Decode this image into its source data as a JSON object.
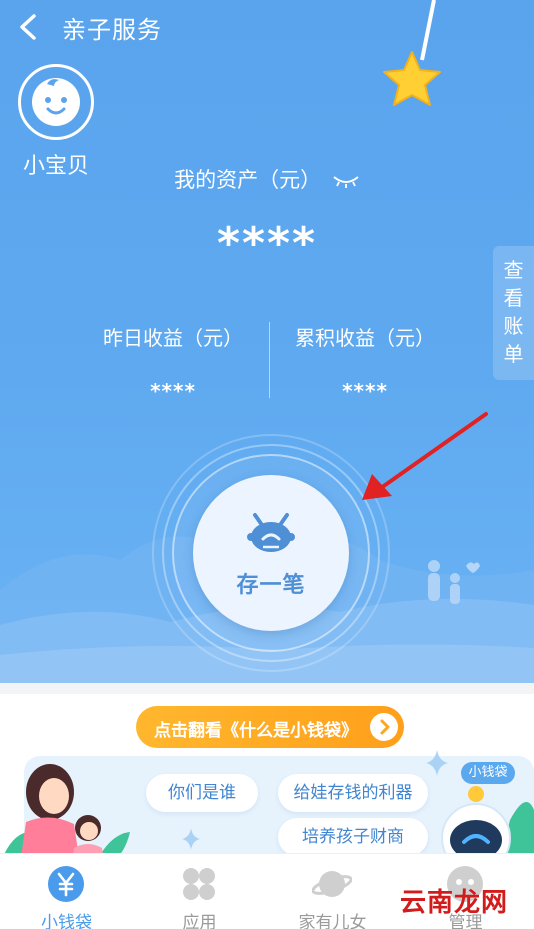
{
  "header": {
    "title": "亲子服务"
  },
  "profile": {
    "name": "小宝贝"
  },
  "assets": {
    "label": "我的资产（元）",
    "value": "****"
  },
  "earnings": {
    "yesterday_label": "昨日收益（元）",
    "yesterday_value": "****",
    "total_label": "累积收益（元）",
    "total_value": "****"
  },
  "side_tab": {
    "chars": [
      "查",
      "看",
      "账",
      "单"
    ]
  },
  "deposit": {
    "label": "存一笔"
  },
  "guide": {
    "text": "点击翻看《什么是小钱袋》"
  },
  "banner": {
    "chips": [
      "你们是谁",
      "给娃存钱的利器",
      "培养孩子财商"
    ],
    "tag": "小钱袋"
  },
  "tabbar": {
    "items": [
      {
        "label": "小钱袋",
        "icon": "yen-coin-icon",
        "active": true
      },
      {
        "label": "应用",
        "icon": "apps-clover-icon",
        "active": false
      },
      {
        "label": "家有儿女",
        "icon": "planet-icon",
        "active": false
      },
      {
        "label": "管理",
        "icon": "robot-face-icon",
        "active": false
      }
    ]
  },
  "watermark": {
    "text": "云南龙网"
  },
  "colors": {
    "primary": "#5aa4ee",
    "accent": "#ffa51f",
    "active_tab": "#4a9bec",
    "arrow": "#e02222"
  }
}
